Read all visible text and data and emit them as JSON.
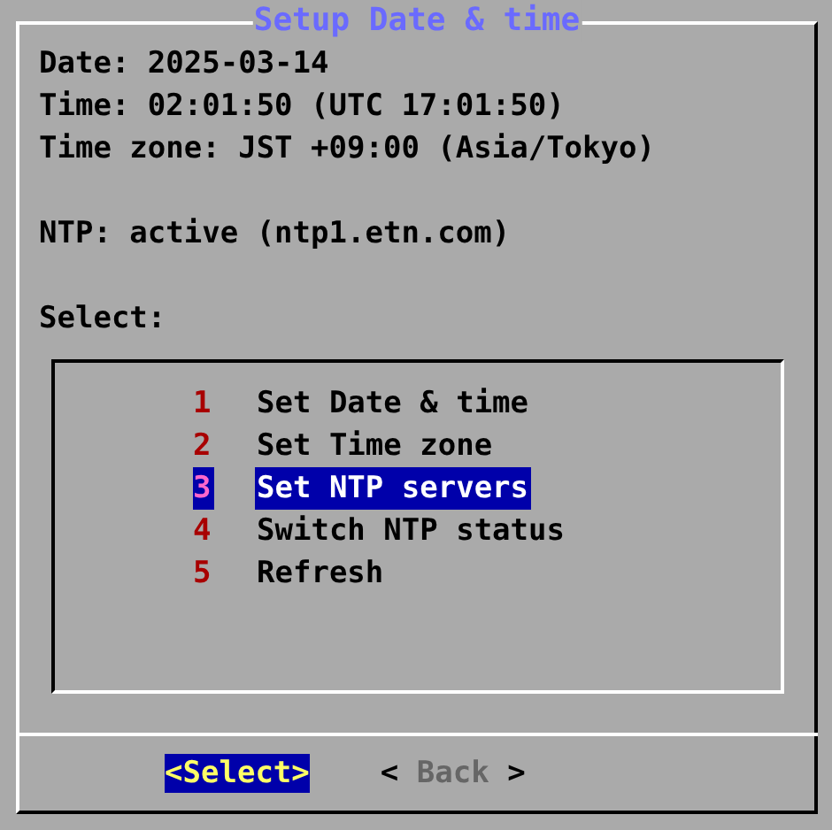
{
  "dialog": {
    "title": "Setup Date & time",
    "info_lines": [
      "Date: 2025-03-14",
      "Time: 02:01:50 (UTC 17:01:50)",
      "Time zone: JST +09:00 (Asia/Tokyo)"
    ],
    "ntp_line": "NTP: active (ntp1.etn.com)",
    "prompt": "Select:",
    "menu": [
      {
        "number": "1",
        "label": "Set Date & time",
        "selected": false
      },
      {
        "number": "2",
        "label": "Set Time zone",
        "selected": false
      },
      {
        "number": "3",
        "label": "Set NTP servers",
        "selected": true
      },
      {
        "number": "4",
        "label": "Switch NTP status",
        "selected": false
      },
      {
        "number": "5",
        "label": "Refresh",
        "selected": false
      }
    ],
    "buttons": [
      {
        "label": "<Select>",
        "selected": true
      },
      {
        "label": "< Back >",
        "selected": false
      }
    ]
  }
}
